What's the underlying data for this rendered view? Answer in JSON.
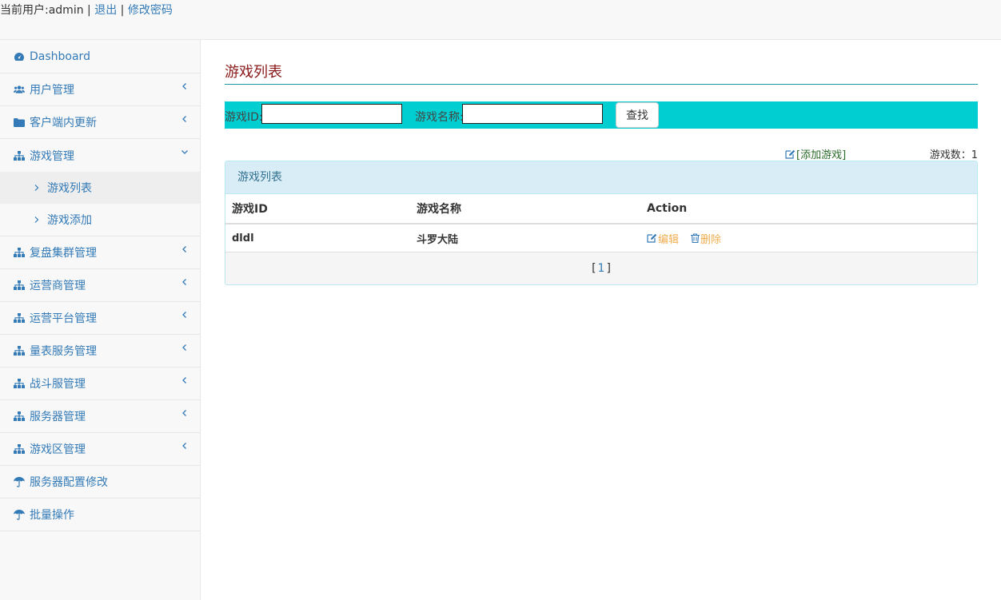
{
  "topbar": {
    "current_user_label": "当前用户:admin",
    "sep1": " | ",
    "logout": "退出",
    "sep2": " | ",
    "change_password": "修改密码"
  },
  "sidebar": {
    "items": [
      {
        "label": "Dashboard",
        "icon": "dashboard-icon"
      },
      {
        "label": "用户管理",
        "icon": "users-icon"
      },
      {
        "label": "客户端内更新",
        "icon": "folder-icon"
      },
      {
        "label": "游戏管理",
        "icon": "sitemap-icon"
      },
      {
        "label": "复盘集群管理",
        "icon": "sitemap-icon"
      },
      {
        "label": "运营商管理",
        "icon": "sitemap-icon"
      },
      {
        "label": "运营平台管理",
        "icon": "sitemap-icon"
      },
      {
        "label": "量表服务管理",
        "icon": "sitemap-icon"
      },
      {
        "label": "战斗服管理",
        "icon": "sitemap-icon"
      },
      {
        "label": "服务器管理",
        "icon": "sitemap-icon"
      },
      {
        "label": "游戏区管理",
        "icon": "sitemap-icon"
      },
      {
        "label": "服务器配置修改",
        "icon": "umbrella-icon"
      },
      {
        "label": "批量操作",
        "icon": "umbrella-icon"
      }
    ],
    "sub_items": [
      {
        "label": "游戏列表"
      },
      {
        "label": "游戏添加"
      }
    ]
  },
  "main": {
    "title": "游戏列表",
    "search": {
      "game_id_label": "游戏ID:",
      "game_id_value": "",
      "game_name_label": "游戏名称:",
      "game_name_value": "",
      "button": "查找"
    },
    "add_game": "[添加游戏]",
    "count_label": "游戏数：1",
    "panel_title": "游戏列表",
    "table": {
      "headers": [
        "游戏ID",
        "游戏名称",
        "Action"
      ],
      "rows": [
        {
          "id": "dldl",
          "name": "斗罗大陆",
          "edit": "编辑",
          "delete": "删除"
        }
      ]
    },
    "pager": {
      "open": "[",
      "page": "1",
      "close": " ]"
    }
  },
  "colors": {
    "link": "#337ab7",
    "search_bar": "#00ced1",
    "title": "#8b1a1a",
    "action": "#f0ad4e",
    "panel_head": "#d9edf7"
  }
}
